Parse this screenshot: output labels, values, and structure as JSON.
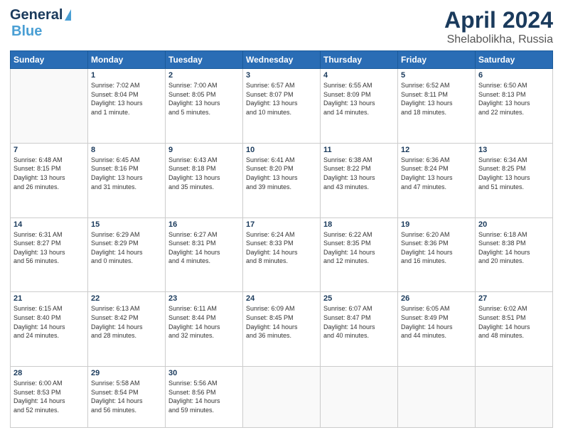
{
  "header": {
    "logo_line1": "General",
    "logo_line2": "Blue",
    "title": "April 2024",
    "subtitle": "Shelabolikha, Russia"
  },
  "weekdays": [
    "Sunday",
    "Monday",
    "Tuesday",
    "Wednesday",
    "Thursday",
    "Friday",
    "Saturday"
  ],
  "weeks": [
    [
      {
        "day": "",
        "info": ""
      },
      {
        "day": "1",
        "info": "Sunrise: 7:02 AM\nSunset: 8:04 PM\nDaylight: 13 hours\nand 1 minute."
      },
      {
        "day": "2",
        "info": "Sunrise: 7:00 AM\nSunset: 8:05 PM\nDaylight: 13 hours\nand 5 minutes."
      },
      {
        "day": "3",
        "info": "Sunrise: 6:57 AM\nSunset: 8:07 PM\nDaylight: 13 hours\nand 10 minutes."
      },
      {
        "day": "4",
        "info": "Sunrise: 6:55 AM\nSunset: 8:09 PM\nDaylight: 13 hours\nand 14 minutes."
      },
      {
        "day": "5",
        "info": "Sunrise: 6:52 AM\nSunset: 8:11 PM\nDaylight: 13 hours\nand 18 minutes."
      },
      {
        "day": "6",
        "info": "Sunrise: 6:50 AM\nSunset: 8:13 PM\nDaylight: 13 hours\nand 22 minutes."
      }
    ],
    [
      {
        "day": "7",
        "info": "Sunrise: 6:48 AM\nSunset: 8:15 PM\nDaylight: 13 hours\nand 26 minutes."
      },
      {
        "day": "8",
        "info": "Sunrise: 6:45 AM\nSunset: 8:16 PM\nDaylight: 13 hours\nand 31 minutes."
      },
      {
        "day": "9",
        "info": "Sunrise: 6:43 AM\nSunset: 8:18 PM\nDaylight: 13 hours\nand 35 minutes."
      },
      {
        "day": "10",
        "info": "Sunrise: 6:41 AM\nSunset: 8:20 PM\nDaylight: 13 hours\nand 39 minutes."
      },
      {
        "day": "11",
        "info": "Sunrise: 6:38 AM\nSunset: 8:22 PM\nDaylight: 13 hours\nand 43 minutes."
      },
      {
        "day": "12",
        "info": "Sunrise: 6:36 AM\nSunset: 8:24 PM\nDaylight: 13 hours\nand 47 minutes."
      },
      {
        "day": "13",
        "info": "Sunrise: 6:34 AM\nSunset: 8:25 PM\nDaylight: 13 hours\nand 51 minutes."
      }
    ],
    [
      {
        "day": "14",
        "info": "Sunrise: 6:31 AM\nSunset: 8:27 PM\nDaylight: 13 hours\nand 56 minutes."
      },
      {
        "day": "15",
        "info": "Sunrise: 6:29 AM\nSunset: 8:29 PM\nDaylight: 14 hours\nand 0 minutes."
      },
      {
        "day": "16",
        "info": "Sunrise: 6:27 AM\nSunset: 8:31 PM\nDaylight: 14 hours\nand 4 minutes."
      },
      {
        "day": "17",
        "info": "Sunrise: 6:24 AM\nSunset: 8:33 PM\nDaylight: 14 hours\nand 8 minutes."
      },
      {
        "day": "18",
        "info": "Sunrise: 6:22 AM\nSunset: 8:35 PM\nDaylight: 14 hours\nand 12 minutes."
      },
      {
        "day": "19",
        "info": "Sunrise: 6:20 AM\nSunset: 8:36 PM\nDaylight: 14 hours\nand 16 minutes."
      },
      {
        "day": "20",
        "info": "Sunrise: 6:18 AM\nSunset: 8:38 PM\nDaylight: 14 hours\nand 20 minutes."
      }
    ],
    [
      {
        "day": "21",
        "info": "Sunrise: 6:15 AM\nSunset: 8:40 PM\nDaylight: 14 hours\nand 24 minutes."
      },
      {
        "day": "22",
        "info": "Sunrise: 6:13 AM\nSunset: 8:42 PM\nDaylight: 14 hours\nand 28 minutes."
      },
      {
        "day": "23",
        "info": "Sunrise: 6:11 AM\nSunset: 8:44 PM\nDaylight: 14 hours\nand 32 minutes."
      },
      {
        "day": "24",
        "info": "Sunrise: 6:09 AM\nSunset: 8:45 PM\nDaylight: 14 hours\nand 36 minutes."
      },
      {
        "day": "25",
        "info": "Sunrise: 6:07 AM\nSunset: 8:47 PM\nDaylight: 14 hours\nand 40 minutes."
      },
      {
        "day": "26",
        "info": "Sunrise: 6:05 AM\nSunset: 8:49 PM\nDaylight: 14 hours\nand 44 minutes."
      },
      {
        "day": "27",
        "info": "Sunrise: 6:02 AM\nSunset: 8:51 PM\nDaylight: 14 hours\nand 48 minutes."
      }
    ],
    [
      {
        "day": "28",
        "info": "Sunrise: 6:00 AM\nSunset: 8:53 PM\nDaylight: 14 hours\nand 52 minutes."
      },
      {
        "day": "29",
        "info": "Sunrise: 5:58 AM\nSunset: 8:54 PM\nDaylight: 14 hours\nand 56 minutes."
      },
      {
        "day": "30",
        "info": "Sunrise: 5:56 AM\nSunset: 8:56 PM\nDaylight: 14 hours\nand 59 minutes."
      },
      {
        "day": "",
        "info": ""
      },
      {
        "day": "",
        "info": ""
      },
      {
        "day": "",
        "info": ""
      },
      {
        "day": "",
        "info": ""
      }
    ]
  ]
}
